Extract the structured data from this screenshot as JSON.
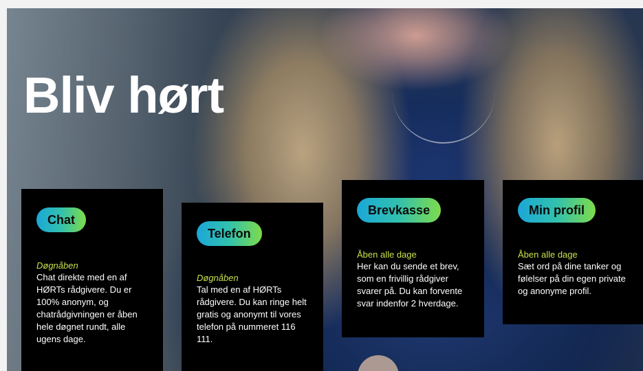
{
  "hero": {
    "title": "Bliv hørt"
  },
  "cards": [
    {
      "label": "Chat",
      "hours": "Døgnåben",
      "description": "Chat direkte med en af HØRTs rådgivere. Du er 100% anonym, og chatrådgivningen er åben hele døgnet rundt, alle ugens dage."
    },
    {
      "label": "Telefon",
      "hours": "Døgnåben",
      "description": "Tal med en af HØRTs rådgivere. Du kan ringe helt gratis og anonymt til vores telefon på nummeret 116 111."
    },
    {
      "label": "Brevkasse",
      "hours": "Åben alle dage",
      "description": "Her kan du sende et brev, som en frivillig rådgiver svarer på. Du kan forvente svar indenfor 2 hverdage."
    },
    {
      "label": "Min profil",
      "hours": "Åben alle dage",
      "description": "Sæt ord på dine tanker og følelser på din egen private og anonyme profil."
    }
  ],
  "colors": {
    "accent_gradient_start": "#1ba7d8",
    "accent_gradient_end": "#7edb4a",
    "hours_text": "#c6e24b",
    "card_background": "#000000"
  }
}
